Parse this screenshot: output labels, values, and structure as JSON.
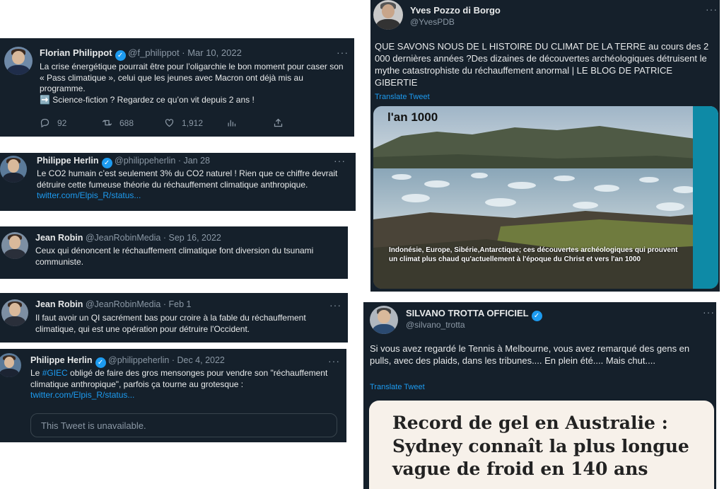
{
  "tweets": [
    {
      "name": "Florian Philippot",
      "handle": "@f_philippot",
      "date": "· Mar 10, 2022",
      "text1": "La crise énergétique pourrait être pour l’oligarchie le bon moment pour caser son « Pass climatique », celui que les jeunes avec Macron ont déjà mis au programme.",
      "text2": "Science-fiction ? Regardez ce qu’on vit depuis 2 ans !",
      "arrow": "➡️",
      "replies": "92",
      "retweets": "688",
      "likes": "1,912"
    },
    {
      "name": "Philippe Herlin",
      "handle": "@philippeherlin",
      "date": "· Jan 28",
      "text": "Le CO2 humain c’est seulement 3% du CO2 naturel ! Rien que ce chiffre devrait détruire cette fumeuse théorie du réchauffement climatique anthropique.",
      "link": "twitter.com/Elpis_R/status..."
    },
    {
      "name": "Jean Robin",
      "handle": "@JeanRobinMedia",
      "date": "· Sep 16, 2022",
      "text": "Ceux qui dénoncent le réchauffement climatique font diversion du tsunami communiste."
    },
    {
      "name": "Jean Robin",
      "handle": "@JeanRobinMedia",
      "date": "· Feb 1",
      "text": "Il faut avoir un QI sacrément bas pour croire à la fable du réchauffement climatique, qui est une opération pour détruire l'Occident."
    },
    {
      "name": "Philippe Herlin",
      "handle": "@philippeherlin",
      "date": "· Dec 4, 2022",
      "text_prefix": "Le ",
      "hashtag": "#GIEC",
      "text_rest": " obligé de faire des gros mensonges pour vendre son \"réchauffement climatique anthropique\", parfois ça tourne au grotesque :",
      "link": "twitter.com/Elpis_R/status...",
      "unavailable": "This Tweet is unavailable."
    },
    {
      "name": "Yves Pozzo di Borgo",
      "handle": "@YvesPDB",
      "text": "QUE SAVONS NOUS DE L HISTOIRE DU CLIMAT DE LA TERRE au cours des 2 000 dernières années ?Des dizaines de découvertes archéologiques détruisent le mythe catastrophiste du réchauffement anormal | LE BLOG DE PATRICE GIBERTIE",
      "translate": "Translate Tweet",
      "image_title": "l'an 1000",
      "image_caption": "Indonésie, Europe, Sibérie,Antarctique; ces découvertes archéologiques qui prouvent un climat plus chaud qu'actuellement  à l'époque du Christ et vers l'an 1000"
    },
    {
      "name": "SILVANO TROTTA OFFICIEL",
      "handle": "@silvano_trotta",
      "text": "Si vous avez regardé le Tennis à Melbourne, vous avez remarqué des gens en pulls, avec des plaids, dans les tribunes.... En plein été.... Mais chut....",
      "translate": "Translate Tweet",
      "headline": "Record de gel en Australie : Sydney connaît la plus longue vague de froid en 140 ans"
    }
  ],
  "icons": {
    "verified": "✓",
    "more": "···"
  }
}
